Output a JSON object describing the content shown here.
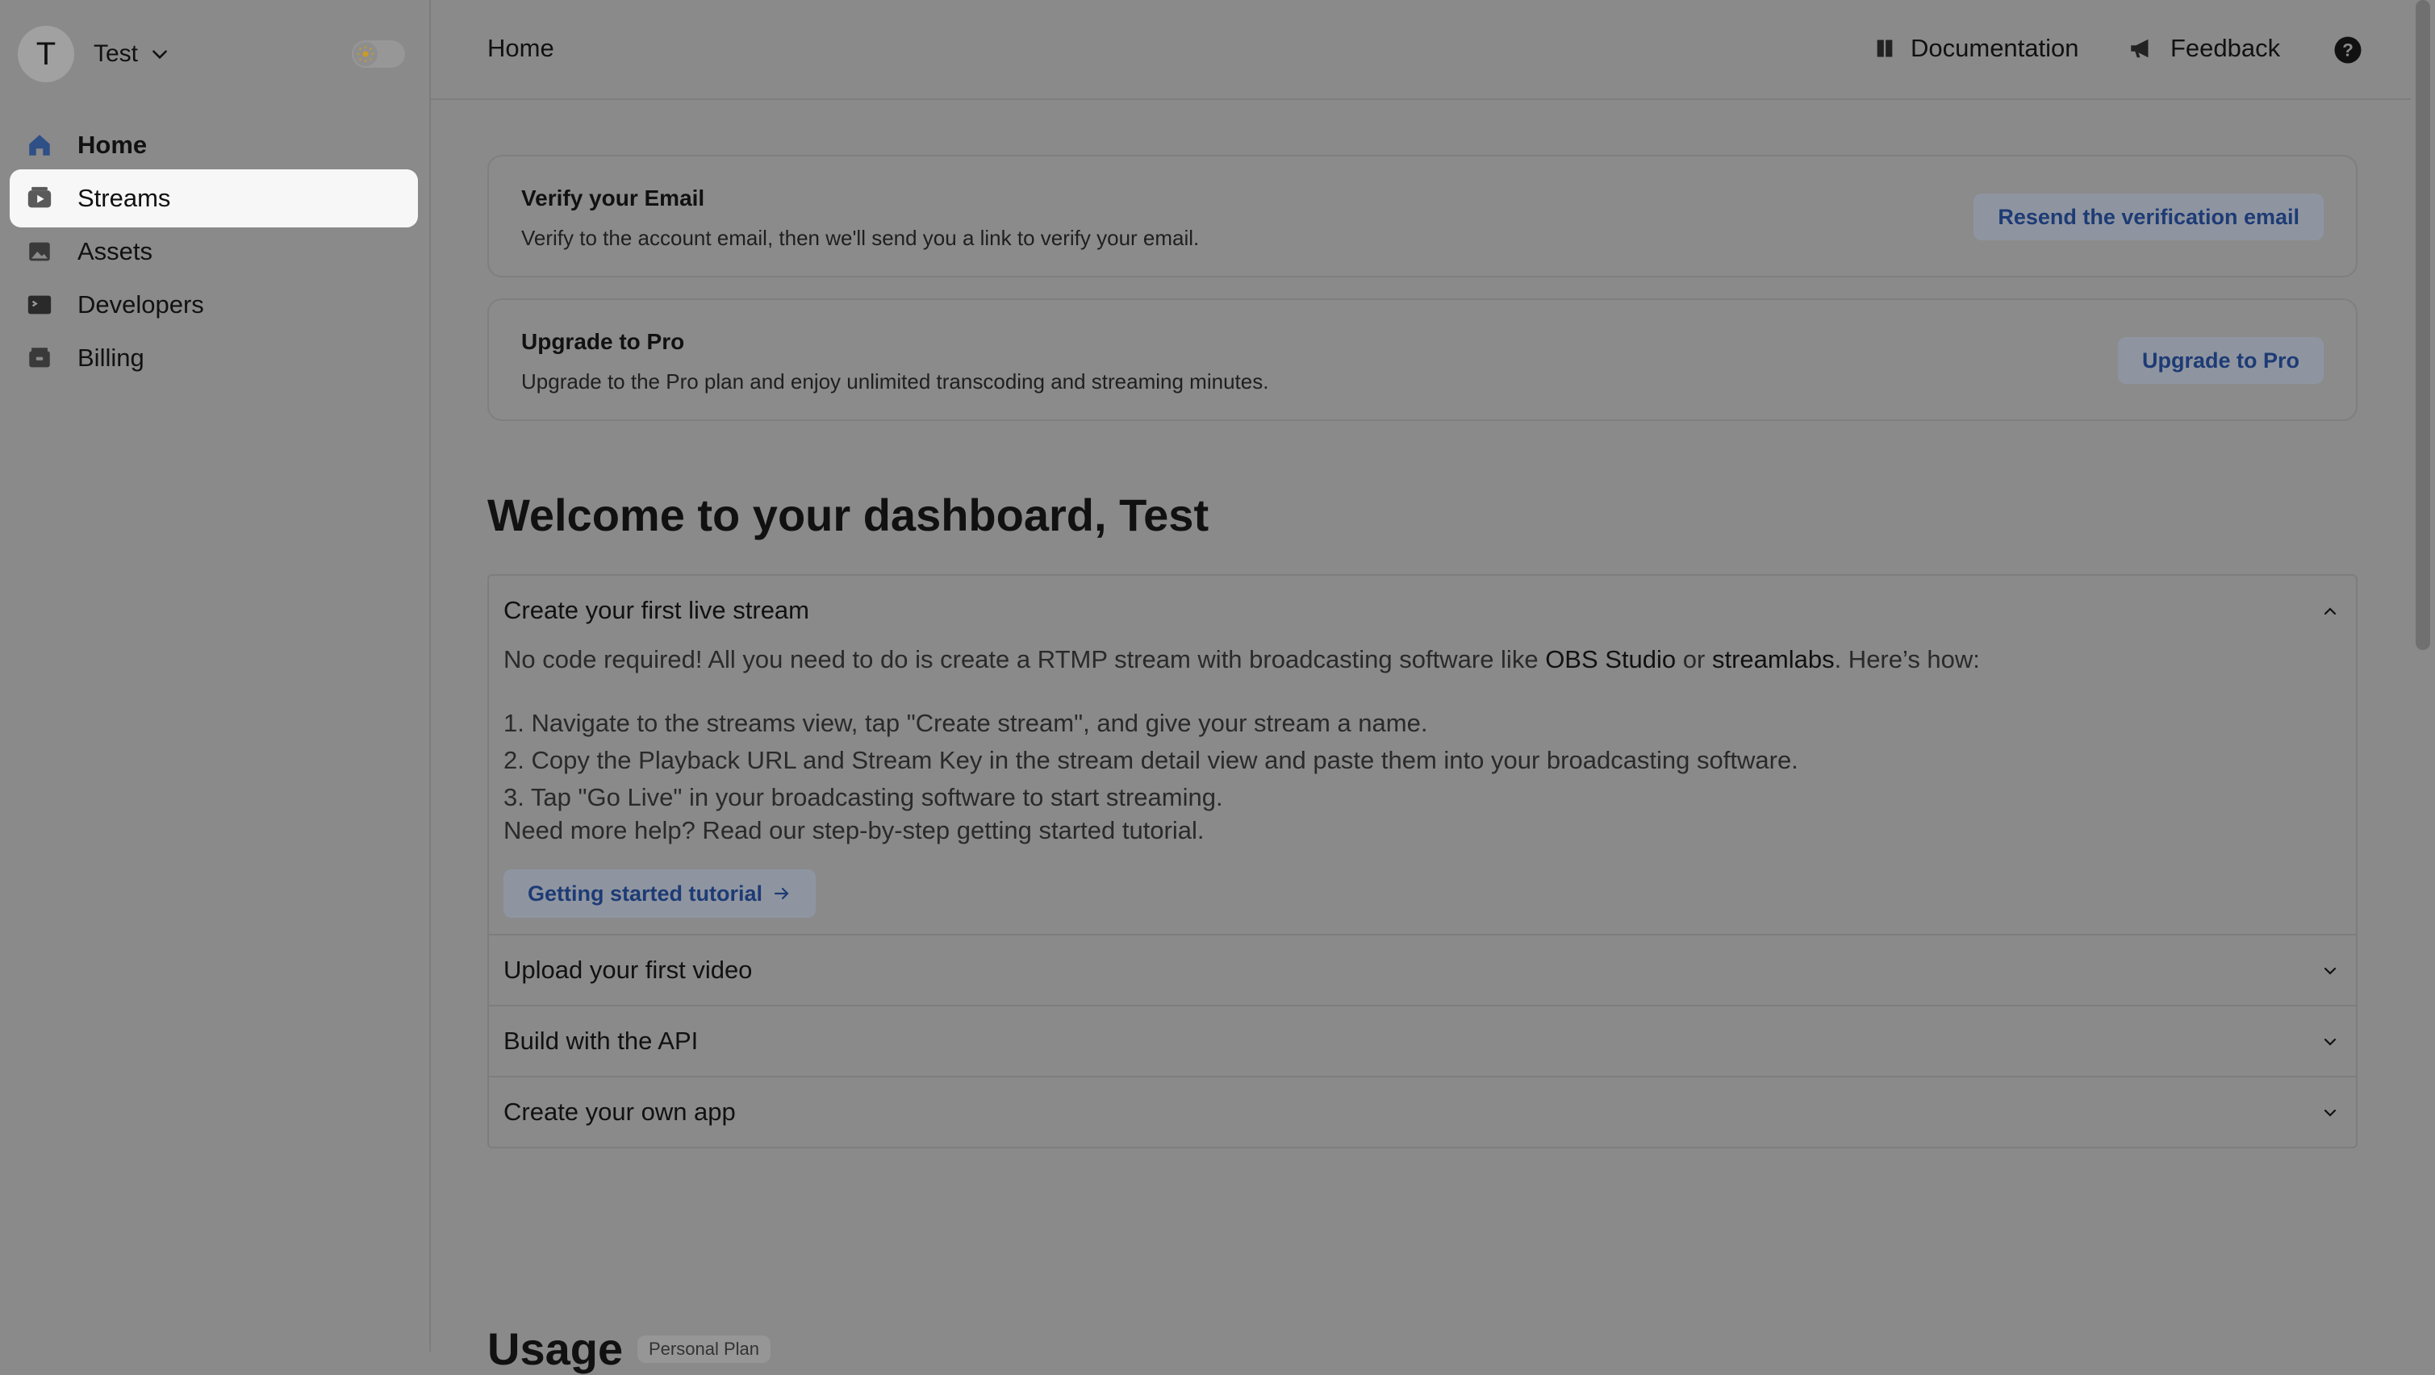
{
  "account": {
    "initial": "T",
    "name": "Test"
  },
  "sidebar": {
    "items": [
      {
        "label": "Home",
        "icon": "home-icon"
      },
      {
        "label": "Streams",
        "icon": "streams-icon"
      },
      {
        "label": "Assets",
        "icon": "assets-icon"
      },
      {
        "label": "Developers",
        "icon": "terminal-icon"
      },
      {
        "label": "Billing",
        "icon": "billing-icon"
      }
    ]
  },
  "topbar": {
    "title": "Home",
    "documentation": "Documentation",
    "feedback": "Feedback"
  },
  "verify": {
    "title": "Verify your Email",
    "text": "Verify to the account email, then we'll send you a link to verify your email.",
    "button": "Resend the verification email"
  },
  "upgrade": {
    "title": "Upgrade to Pro",
    "text": "Upgrade to the Pro plan and enjoy unlimited transcoding and streaming minutes.",
    "button": "Upgrade to Pro"
  },
  "welcome": "Welcome to your dashboard, Test",
  "accordion": {
    "first": {
      "title": "Create your first live stream",
      "intro_a": "No code required! All you need to do is create a RTMP stream with broadcasting software like ",
      "obs": "OBS Studio",
      "or": " or ",
      "streamlabs": "streamlabs",
      "intro_b": ". Here’s how:",
      "step1": "1. Navigate to the streams view, tap \"Create stream\", and give your stream a name.",
      "step2": "2. Copy the Playback URL and Stream Key in the stream detail view and paste them into your broadcasting software.",
      "step3": "3. Tap \"Go Live\" in your broadcasting software to start streaming.",
      "help": "Need more help? Read our step-by-step getting started tutorial.",
      "button": "Getting started tutorial"
    },
    "items": [
      {
        "title": "Upload your first video"
      },
      {
        "title": "Build with the API"
      },
      {
        "title": "Create your own app"
      }
    ]
  },
  "usage": {
    "title": "Usage",
    "plan": "Personal Plan"
  },
  "colors": {
    "accent": "#1d3b75",
    "active_nav": "#f7f7f7"
  }
}
